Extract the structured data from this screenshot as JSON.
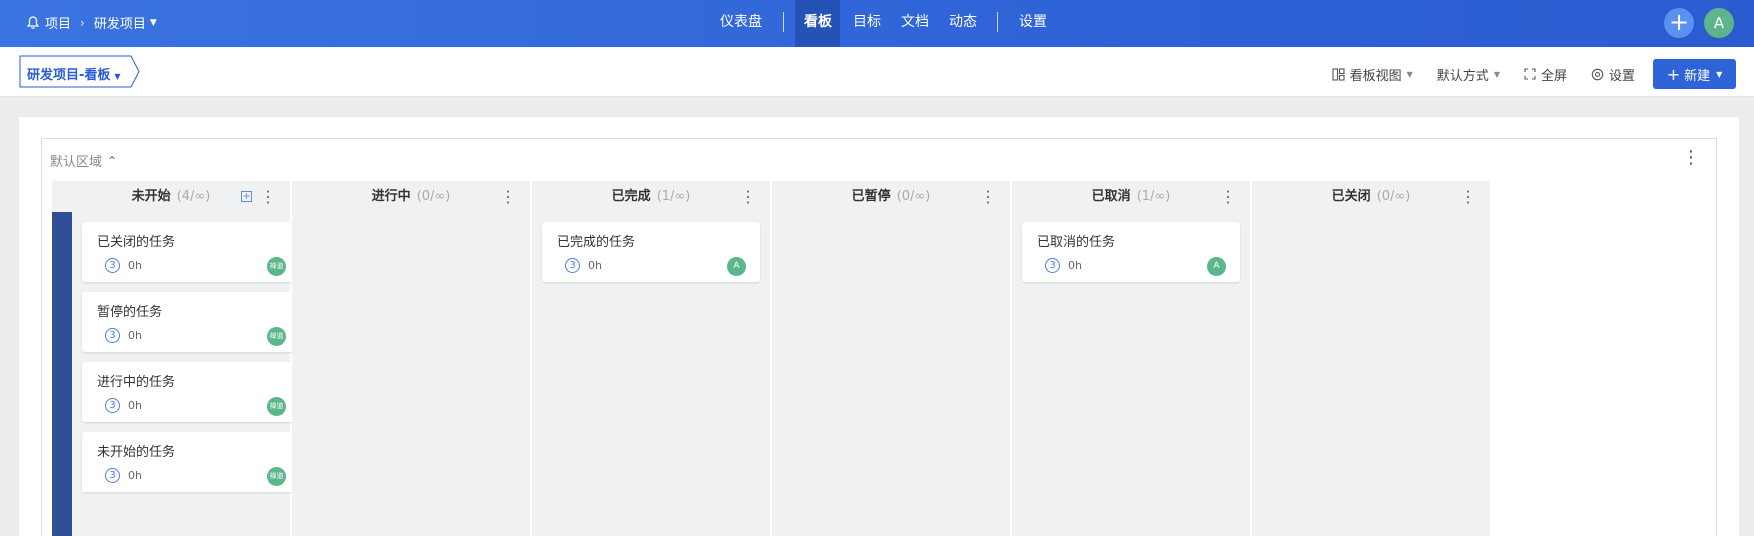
{
  "topbar": {
    "breadcrumb_root": "项目",
    "breadcrumb_project": "研发项目",
    "nav": [
      {
        "label": "仪表盘"
      },
      {
        "label": "看板"
      },
      {
        "label": "目标"
      },
      {
        "label": "文档"
      },
      {
        "label": "动态"
      },
      {
        "label": "设置"
      }
    ],
    "avatar": "A"
  },
  "subbar": {
    "board_name": "研发项目-看板",
    "view_label": "看板视图",
    "sort_label": "默认方式",
    "fullscreen_label": "全屏",
    "settings_label": "设置",
    "new_label": "新建"
  },
  "region": {
    "title": "默认区域"
  },
  "columns": [
    {
      "title": "未开始",
      "count": "(4/∞)"
    },
    {
      "title": "进行中",
      "count": "(0/∞)"
    },
    {
      "title": "已完成",
      "count": "(1/∞)"
    },
    {
      "title": "已暂停",
      "count": "(0/∞)"
    },
    {
      "title": "已取消",
      "count": "(1/∞)"
    },
    {
      "title": "已关闭",
      "count": "(0/∞)"
    }
  ],
  "cards": {
    "todo": [
      {
        "title": "已关闭的任务",
        "priority": "3",
        "hours": "0h",
        "assignee": "禅道"
      },
      {
        "title": "暂停的任务",
        "priority": "3",
        "hours": "0h",
        "assignee": "禅道"
      },
      {
        "title": "进行中的任务",
        "priority": "3",
        "hours": "0h",
        "assignee": "禅道"
      },
      {
        "title": "未开始的任务",
        "priority": "3",
        "hours": "0h",
        "assignee": "禅道"
      }
    ],
    "done": [
      {
        "title": "已完成的任务",
        "priority": "3",
        "hours": "0h",
        "assignee": "A"
      }
    ],
    "cancelled": [
      {
        "title": "已取消的任务",
        "priority": "3",
        "hours": "0h",
        "assignee": "A"
      }
    ]
  },
  "colors": {
    "topbar": "#2f63d8",
    "accent": "#2a5bd7",
    "avatar": "#5cb58b",
    "lane_stripe": "#2e4e96"
  }
}
